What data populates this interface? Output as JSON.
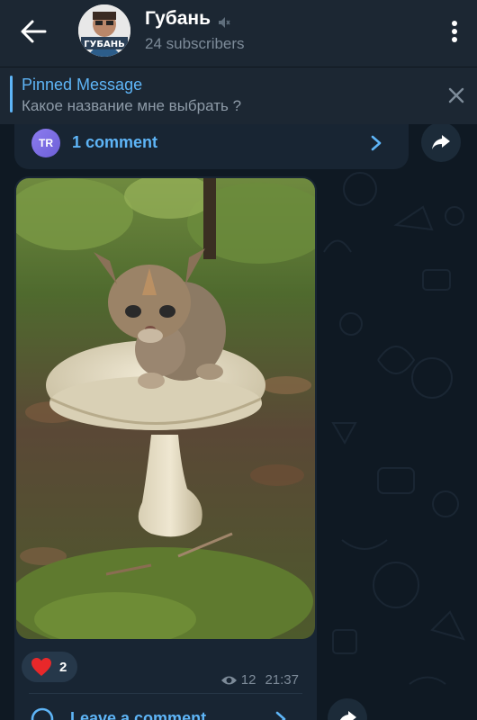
{
  "header": {
    "back_icon": "arrow-left-icon",
    "channel_name": "Губань",
    "avatar_text": "ГУБАНЬ",
    "muted_icon": "muted-speaker-icon",
    "subscribers": "24 subscribers",
    "menu_icon": "more-vertical-icon"
  },
  "pinned": {
    "title": "Pinned Message",
    "text": "Какое название мне выбрать ?",
    "close_icon": "close-icon"
  },
  "previous_post": {
    "avatar_initials": "TR",
    "comments_label": "1 comment"
  },
  "post": {
    "photo_description_icon": "kitten-on-mushroom-photo",
    "reaction_emoji": "heart",
    "reaction_count": "2",
    "views": "12",
    "time": "21:37",
    "leave_comment": "Leave a comment"
  },
  "colors": {
    "accent": "#5eb5f7",
    "header_bg": "#1c2733",
    "bubble_bg": "#182533",
    "chat_bg": "#0e1621"
  }
}
